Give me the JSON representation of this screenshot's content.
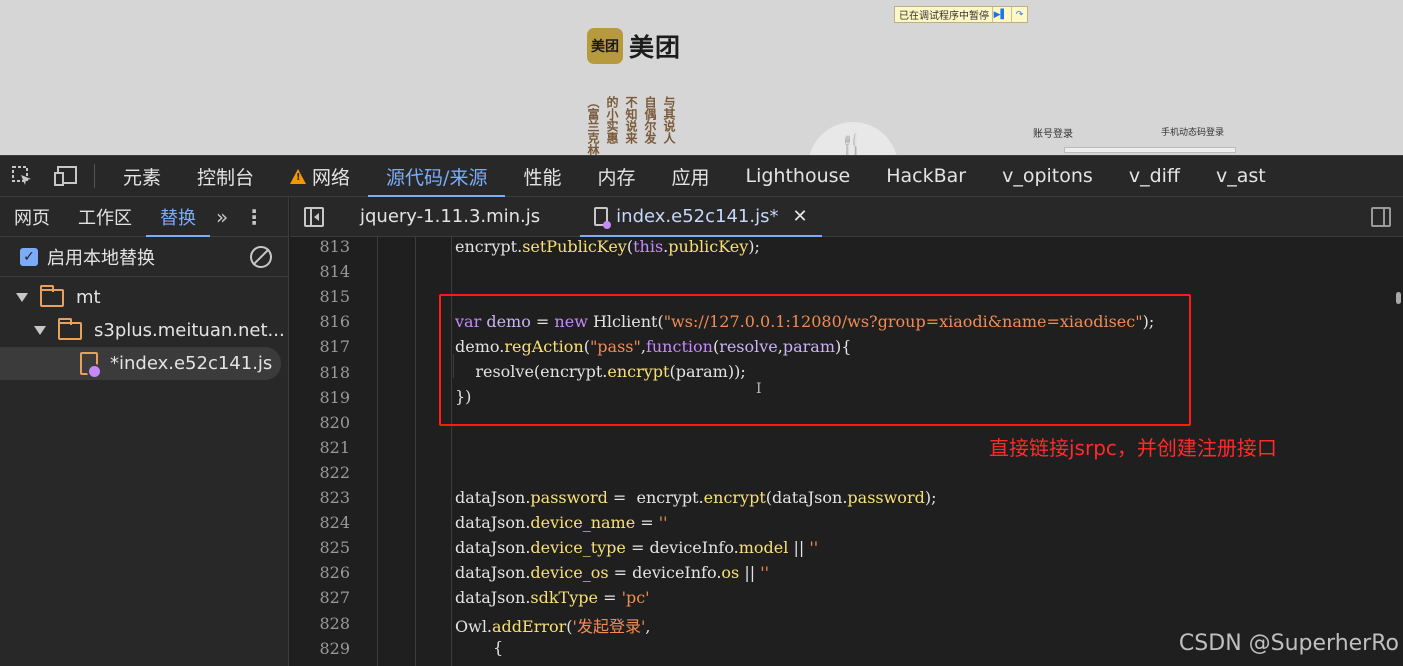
{
  "page": {
    "paused_banner": "已在调试程序中暂停",
    "logo_mark": "美团",
    "logo_text": "美团",
    "poem_cols": [
      "与其说人",
      "自偶尔发",
      "不知说来",
      "的小实惠",
      "（富兰克林"
    ],
    "login_account_tab": "账号登录",
    "login_phone_tab": "手机动态码登录"
  },
  "toolbar": {
    "tabs": [
      "元素",
      "控制台",
      "网络",
      "源代码/来源",
      "性能",
      "内存",
      "应用",
      "Lighthouse",
      "HackBar",
      "v_opitons",
      "v_diff",
      "v_ast"
    ],
    "active_tab": "源代码/来源",
    "warning_tab": "网络"
  },
  "navigator": {
    "tabs": [
      "网页",
      "工作区",
      "替换"
    ],
    "active_tab": "替换",
    "enable_overrides_label": "启用本地替换",
    "tree": [
      {
        "label": "mt",
        "type": "folder"
      },
      {
        "label": "s3plus.meituan.net...",
        "type": "folder"
      },
      {
        "label": "*index.e52c141.js",
        "type": "file",
        "selected": true
      }
    ]
  },
  "editor": {
    "tabs": [
      {
        "label": "jquery-1.11.3.min.js",
        "active": false
      },
      {
        "label": "index.e52c141.js*",
        "active": true
      }
    ],
    "annotation": "直接链接jsrpc，并创建注册接口",
    "watermark": "CSDN @SuperherRo",
    "line_numbers": [
      "813",
      "814",
      "815",
      "816",
      "817",
      "818",
      "819",
      "820",
      "821",
      "822",
      "823",
      "824",
      "825",
      "826",
      "827",
      "828",
      "829"
    ]
  }
}
